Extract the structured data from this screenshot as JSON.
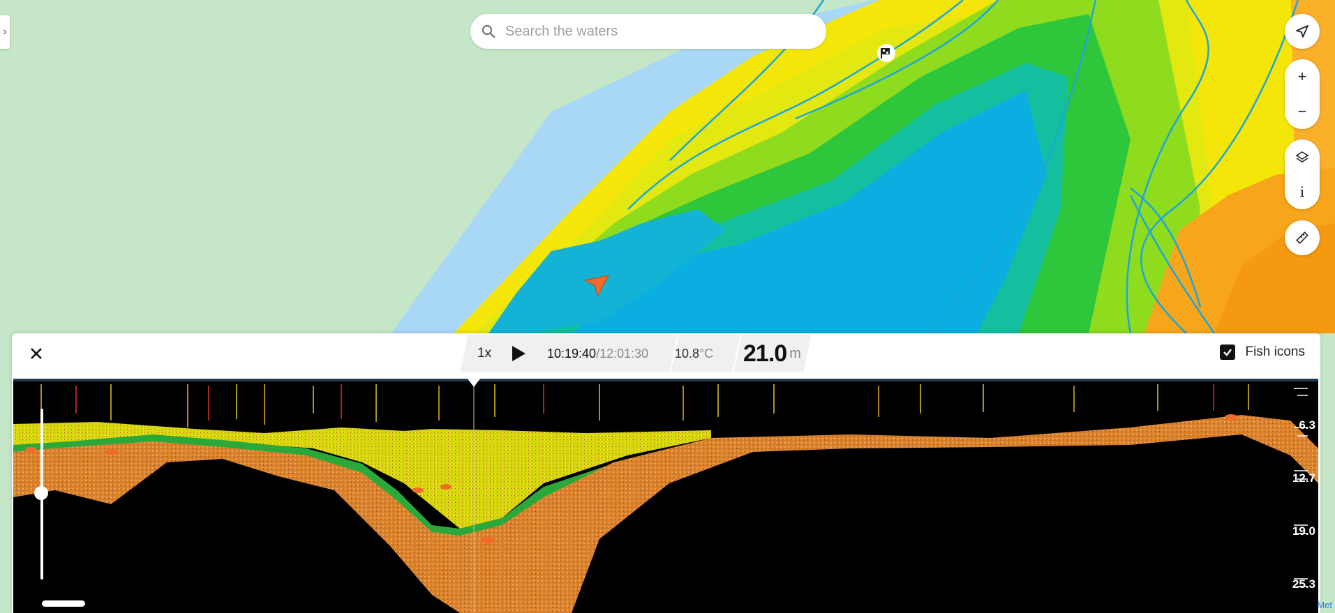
{
  "search": {
    "placeholder": "Search the waters"
  },
  "map_controls": {
    "locate_icon": "navigation-arrow-icon",
    "zoom_in_label": "+",
    "zoom_out_label": "−",
    "layers_icon": "layers-icon",
    "info_label": "i",
    "measure_icon": "ruler-icon"
  },
  "sonar_panel": {
    "close_icon": "close-icon",
    "playback_speed": "1x",
    "current_time": "10:19:40",
    "separator": " / ",
    "total_time": "12:01:30",
    "temperature_value": "10.8",
    "temperature_unit": "°C",
    "depth_value": "21.0",
    "depth_unit": "m",
    "fish_icons_label": "Fish icons",
    "fish_icons_checked": true,
    "depth_scale": [
      "6.3",
      "12.7",
      "19.0",
      "25.3"
    ],
    "attribution": "Met"
  },
  "colors": {
    "water_light": "#a9d8f7",
    "land": "#c6e7c7",
    "deep": "#0aa6dd",
    "boat_marker": "#f26b2a",
    "sonar_bottom": "#d9822b"
  }
}
